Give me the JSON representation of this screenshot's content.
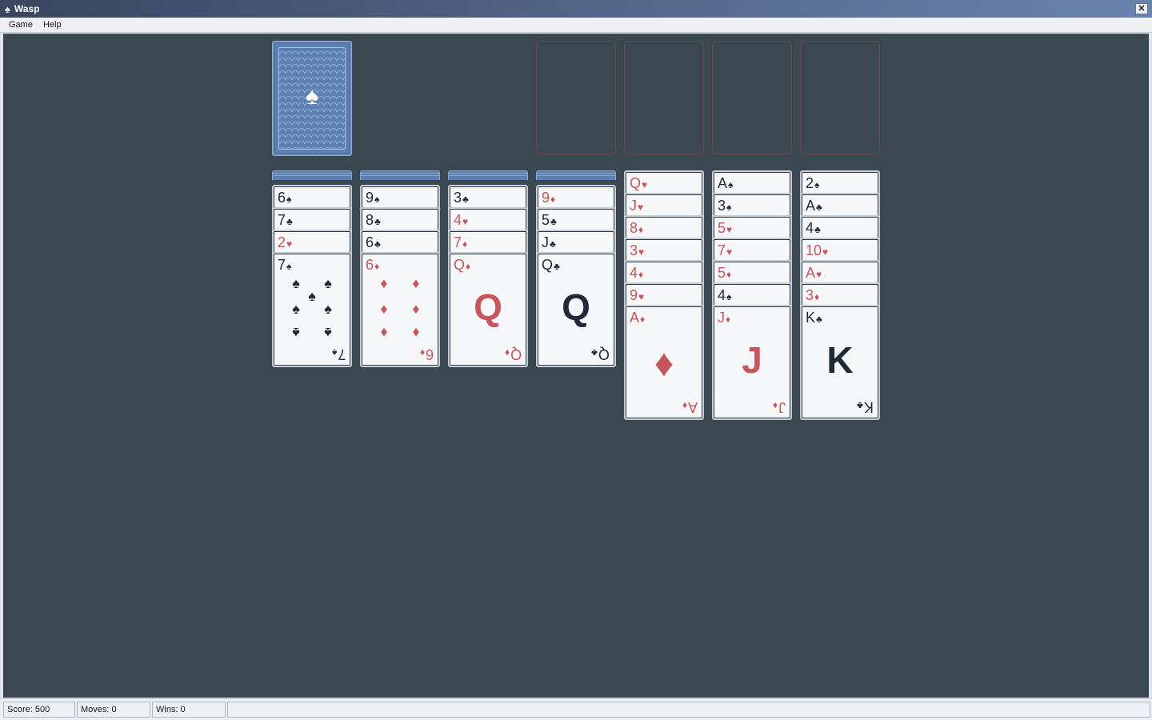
{
  "window": {
    "title": "Wasp",
    "title_icon": "spade-icon",
    "close_label": "✕"
  },
  "menu": [
    "Game",
    "Help"
  ],
  "status": {
    "score": "Score: 500",
    "moves": "Moves: 0",
    "wins": "Wins: 0"
  },
  "stock": {
    "count": "1",
    "back_symbol": "♠"
  },
  "foundations": 4,
  "columns": [
    {
      "hidden": 3,
      "cards": [
        [
          "6",
          "♠"
        ],
        [
          "7",
          "♣"
        ],
        [
          "2",
          "♥"
        ],
        [
          "7",
          "♠"
        ]
      ]
    },
    {
      "hidden": 3,
      "cards": [
        [
          "9",
          "♠"
        ],
        [
          "8",
          "♣"
        ],
        [
          "6",
          "♣"
        ],
        [
          "6",
          "♦"
        ]
      ]
    },
    {
      "hidden": 3,
      "cards": [
        [
          "3",
          "♣"
        ],
        [
          "4",
          "♥"
        ],
        [
          "7",
          "♦"
        ],
        [
          "Q",
          "♦"
        ]
      ]
    },
    {
      "hidden": 3,
      "cards": [
        [
          "9",
          "♦"
        ],
        [
          "5",
          "♣"
        ],
        [
          "J",
          "♣"
        ],
        [
          "Q",
          "♣"
        ]
      ]
    },
    {
      "hidden": 0,
      "cards": [
        [
          "Q",
          "♥"
        ],
        [
          "J",
          "♥"
        ],
        [
          "8",
          "♦"
        ],
        [
          "3",
          "♥"
        ],
        [
          "4",
          "♦"
        ],
        [
          "9",
          "♥"
        ],
        [
          "A",
          "♦"
        ]
      ]
    },
    {
      "hidden": 0,
      "cards": [
        [
          "A",
          "♠"
        ],
        [
          "3",
          "♠"
        ],
        [
          "5",
          "♥"
        ],
        [
          "7",
          "♥"
        ],
        [
          "5",
          "♦"
        ],
        [
          "4",
          "♠"
        ],
        [
          "J",
          "♦"
        ]
      ]
    },
    {
      "hidden": 0,
      "cards": [
        [
          "2",
          "♠"
        ],
        [
          "A",
          "♣"
        ],
        [
          "4",
          "♣"
        ],
        [
          "10",
          "♥"
        ],
        [
          "A",
          "♥"
        ],
        [
          "3",
          "♦"
        ],
        [
          "K",
          "♣"
        ]
      ]
    }
  ]
}
